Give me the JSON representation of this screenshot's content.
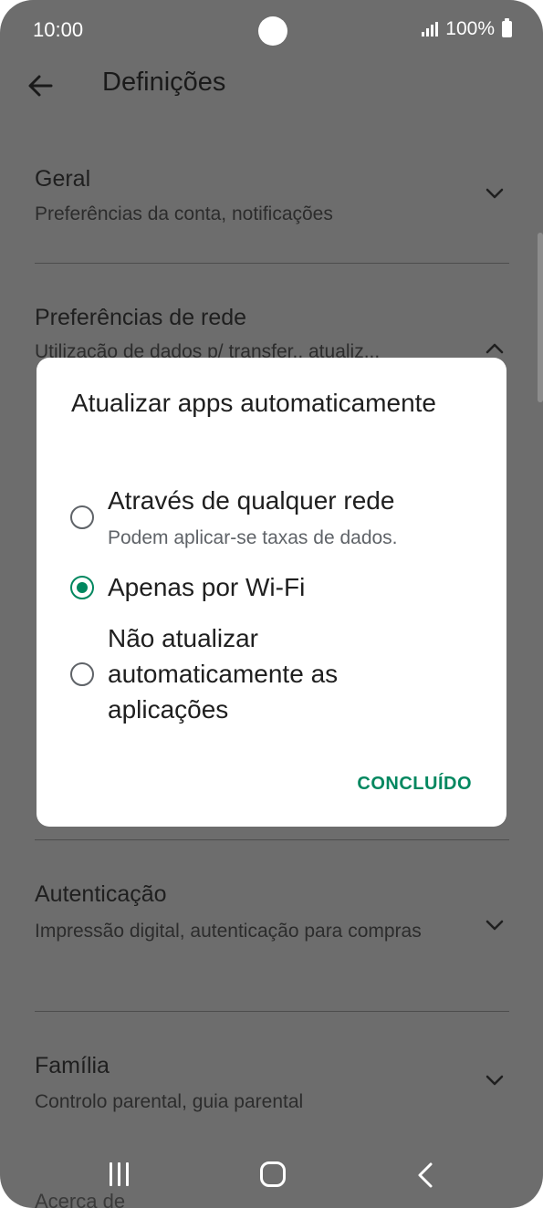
{
  "status": {
    "time": "10:00",
    "battery": "100%"
  },
  "appbar": {
    "title": "Definições"
  },
  "sections": [
    {
      "title": "Geral",
      "subtitle": "Preferências da conta, notificações"
    },
    {
      "title": "Preferências de rede",
      "subtitle": "Utilização de dados p/ transfer., atualiz..."
    },
    {
      "title": "Autenticação",
      "subtitle": "Impressão digital, autenticação para compras"
    },
    {
      "title": "Família",
      "subtitle": "Controlo parental, guia parental"
    },
    {
      "title": "Acerca de"
    }
  ],
  "dialog": {
    "title": "Atualizar apps automaticamente",
    "options": [
      {
        "label": "Através de qualquer rede",
        "sub": "Podem aplicar-se taxas de dados.",
        "selected": false
      },
      {
        "label": "Apenas por Wi-Fi",
        "selected": true
      },
      {
        "label": "Não atualizar automaticamente as aplicações",
        "selected": false
      }
    ],
    "done_label": "CONCLUÍDO"
  },
  "colors": {
    "accent": "#01875f",
    "scrim": "#6d6d6d"
  },
  "icons": {
    "back": "arrow-left-icon",
    "expand": "chevron-down-icon",
    "collapse": "chevron-up-icon"
  }
}
